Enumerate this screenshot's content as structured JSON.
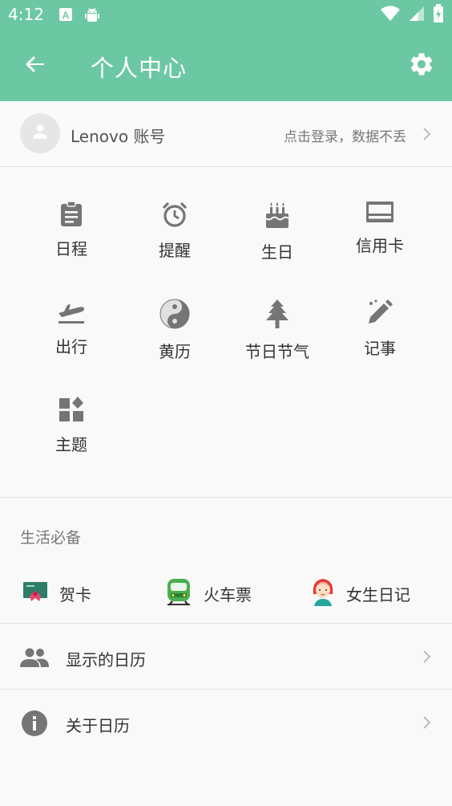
{
  "status_bar": {
    "time": "4:12"
  },
  "toolbar": {
    "title": "个人中心"
  },
  "account": {
    "label": "Lenovo 账号",
    "hint": "点击登录，数据不丢"
  },
  "features": [
    {
      "label": "日程",
      "icon": "clipboard-icon"
    },
    {
      "label": "提醒",
      "icon": "alarm-clock-icon"
    },
    {
      "label": "生日",
      "icon": "birthday-cake-icon"
    },
    {
      "label": "信用卡",
      "icon": "credit-card-icon"
    },
    {
      "label": "出行",
      "icon": "airplane-takeoff-icon"
    },
    {
      "label": "黄历",
      "icon": "yin-yang-icon"
    },
    {
      "label": "节日节气",
      "icon": "pine-tree-icon"
    },
    {
      "label": "记事",
      "icon": "pencil-icon"
    },
    {
      "label": "主题",
      "icon": "theme-blocks-icon"
    }
  ],
  "life": {
    "title": "生活必备",
    "items": [
      {
        "label": "贺卡",
        "icon": "greeting-card-icon"
      },
      {
        "label": "火车票",
        "icon": "train-icon"
      },
      {
        "label": "女生日记",
        "icon": "girl-avatar-icon"
      }
    ]
  },
  "rows": [
    {
      "label": "显示的日历",
      "icon": "people-icon"
    },
    {
      "label": "关于日历",
      "icon": "info-icon"
    }
  ],
  "colors": {
    "header": "#6cc8a3",
    "background": "#f9f9f9",
    "icon_gray": "#757575"
  }
}
